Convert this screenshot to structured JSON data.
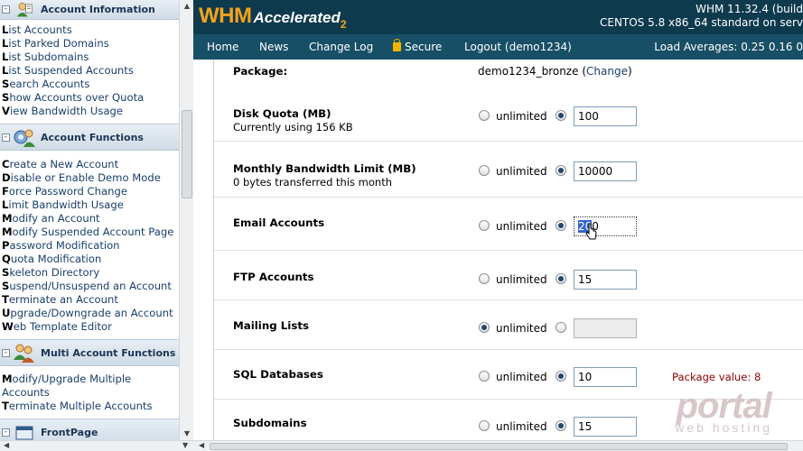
{
  "sidebar": {
    "sections": [
      {
        "title": "Account Information",
        "items": [
          {
            "first": "L",
            "rest": "ist Accounts"
          },
          {
            "first": "L",
            "rest": "ist Parked Domains"
          },
          {
            "first": "L",
            "rest": "ist Subdomains"
          },
          {
            "first": "L",
            "rest": "ist Suspended Accounts"
          },
          {
            "first": "S",
            "rest": "earch Accounts"
          },
          {
            "first": "S",
            "rest": "how Accounts over Quota"
          },
          {
            "first": "V",
            "rest": "iew Bandwidth Usage"
          }
        ]
      },
      {
        "title": "Account Functions",
        "items": [
          {
            "first": "C",
            "rest": "reate a New Account"
          },
          {
            "first": "D",
            "rest": "isable or Enable Demo Mode"
          },
          {
            "first": "F",
            "rest": "orce Password Change"
          },
          {
            "first": "L",
            "rest": "imit Bandwidth Usage"
          },
          {
            "first": "M",
            "rest": "odify an Account"
          },
          {
            "first": "M",
            "rest": "odify Suspended Account Page"
          },
          {
            "first": "P",
            "rest": "assword Modification"
          },
          {
            "first": "Q",
            "rest": "uota Modification"
          },
          {
            "first": "S",
            "rest": "keleton Directory"
          },
          {
            "first": "S",
            "rest": "uspend/Unsuspend an Account"
          },
          {
            "first": "T",
            "rest": "erminate an Account"
          },
          {
            "first": "U",
            "rest": "pgrade/Downgrade an Account"
          },
          {
            "first": "W",
            "rest": "eb Template Editor"
          }
        ]
      },
      {
        "title": "Multi Account Functions",
        "items": [
          {
            "first": "M",
            "rest": "odify/Upgrade Multiple"
          },
          {
            "first": "",
            "rest": "Accounts"
          },
          {
            "first": "T",
            "rest": "erminate Multiple Accounts"
          }
        ]
      },
      {
        "title": "FrontPage",
        "items": []
      }
    ]
  },
  "header": {
    "logo_whm": "WHM",
    "logo_accelerated": "Accelerated",
    "logo_two": "2",
    "version": "WHM 11.32.4 (build",
    "os": "CENTOS 5.8 x86_64 standard on serv"
  },
  "nav": {
    "home": "Home",
    "news": "News",
    "changelog": "Change Log",
    "secure": "Secure",
    "logout": "Logout (demo1234)",
    "load": "Load Averages: 0.25 0.16 0"
  },
  "form": {
    "package_label": "Package:",
    "package_value": "demo1234_bronze",
    "change_open": "(",
    "change_link": "Change",
    "change_close": ")",
    "unlimited": "unlimited",
    "rows": [
      {
        "label": "Disk Quota (MB)",
        "sub": "Currently using 156 KB",
        "value": "100"
      },
      {
        "label": "Monthly Bandwidth Limit (MB)",
        "sub": "0 bytes transferred this month",
        "value": "10000"
      },
      {
        "label": "Email Accounts",
        "sub": "",
        "value_sel": "20",
        "value": "0"
      },
      {
        "label": "FTP Accounts",
        "sub": "",
        "value": "15"
      },
      {
        "label": "Mailing Lists",
        "sub": "",
        "value": ""
      },
      {
        "label": "SQL Databases",
        "sub": "",
        "value": "10",
        "note": "Package value: 8"
      },
      {
        "label": "Subdomains",
        "sub": "",
        "value": "15"
      }
    ]
  },
  "watermark": {
    "brand": "portal",
    "tagline": "web hosting"
  }
}
